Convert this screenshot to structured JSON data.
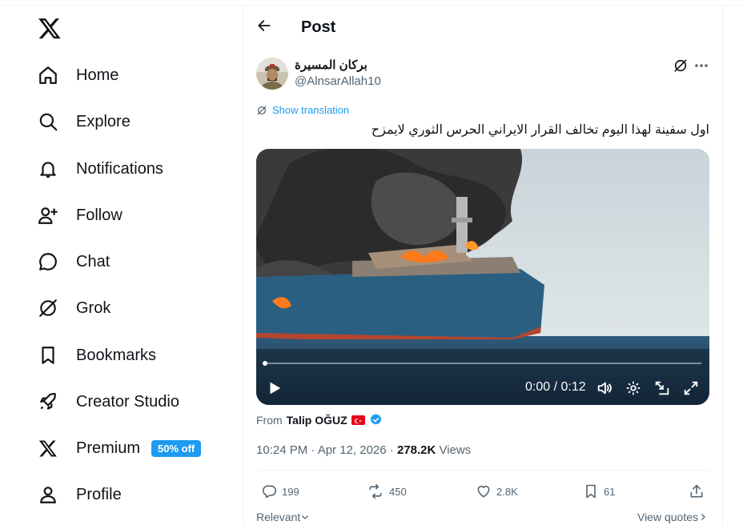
{
  "nav": {
    "items": [
      {
        "label": "Home",
        "icon": "home-icon"
      },
      {
        "label": "Explore",
        "icon": "search-icon"
      },
      {
        "label": "Notifications",
        "icon": "bell-icon"
      },
      {
        "label": "Follow",
        "icon": "person-plus-icon"
      },
      {
        "label": "Chat",
        "icon": "chat-bubble-icon"
      },
      {
        "label": "Grok",
        "icon": "grok-icon"
      },
      {
        "label": "Bookmarks",
        "icon": "bookmark-icon"
      },
      {
        "label": "Creator Studio",
        "icon": "rocket-icon"
      },
      {
        "label": "Premium",
        "icon": "x-icon"
      },
      {
        "label": "Profile",
        "icon": "person-icon"
      }
    ],
    "premium_badge": "50% off"
  },
  "header": {
    "title": "Post"
  },
  "post": {
    "display_name": "بركان المسيرة",
    "handle": "@AlnsarAllah10",
    "show_translation": "Show translation",
    "text": "اول سفينة لهذا اليوم تخالف القرار الايراني الحرس الثوري لايمزح",
    "video": {
      "time": "0:00 / 0:12"
    },
    "from_label": "From",
    "from_name": "Talip OĞUZ",
    "timestamp": "10:24 PM · Apr 12, 2026 · ",
    "views_count": "278.2K",
    "views_label": " Views",
    "stats": {
      "replies": "199",
      "reposts": "450",
      "likes": "2.8K",
      "bookmarks": "61"
    },
    "relevant": "Relevant",
    "view_quotes": "View quotes"
  },
  "colors": {
    "accent": "#1d9bf0",
    "text": "#0f1419",
    "muted": "#536471"
  }
}
